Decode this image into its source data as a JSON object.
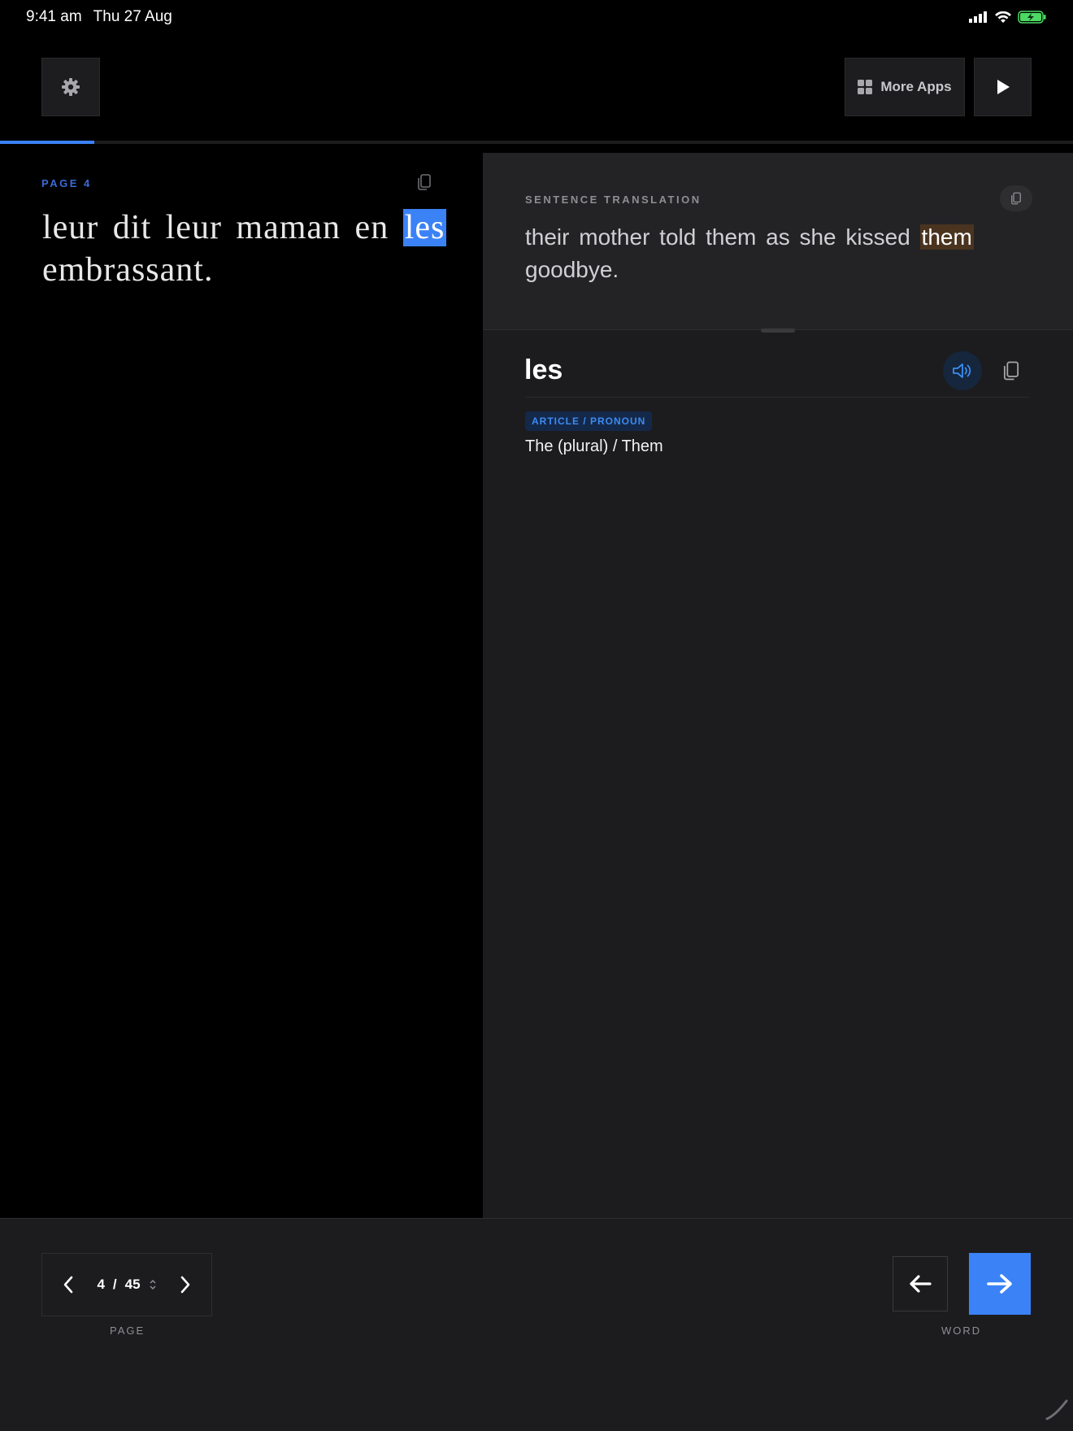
{
  "status_bar": {
    "time": "9:41 am",
    "date": "Thu 27 Aug"
  },
  "toolbar": {
    "more_apps_label": "More Apps"
  },
  "progress": {
    "fraction": 0.088
  },
  "reader": {
    "page_label": "PAGE  4",
    "text_before": "leur dit leur maman en ",
    "highlight_word": "les",
    "text_after": " embrassant."
  },
  "translation": {
    "section_label": "SENTENCE TRANSLATION",
    "text_before": "their mother told them as she kissed ",
    "highlight_word": "them",
    "text_after": " goodbye."
  },
  "word_detail": {
    "word": "les",
    "part_of_speech": "ARTICLE / PRONOUN",
    "definition": "The (plural) / Them"
  },
  "pager": {
    "current": "4",
    "separator": "/",
    "total": "45",
    "label": "PAGE"
  },
  "word_nav": {
    "label": "WORD"
  },
  "colors": {
    "accent": "#3b82f6",
    "translation_highlight": "#4a3420",
    "background": "#000000",
    "panel": "#1c1c1e"
  }
}
